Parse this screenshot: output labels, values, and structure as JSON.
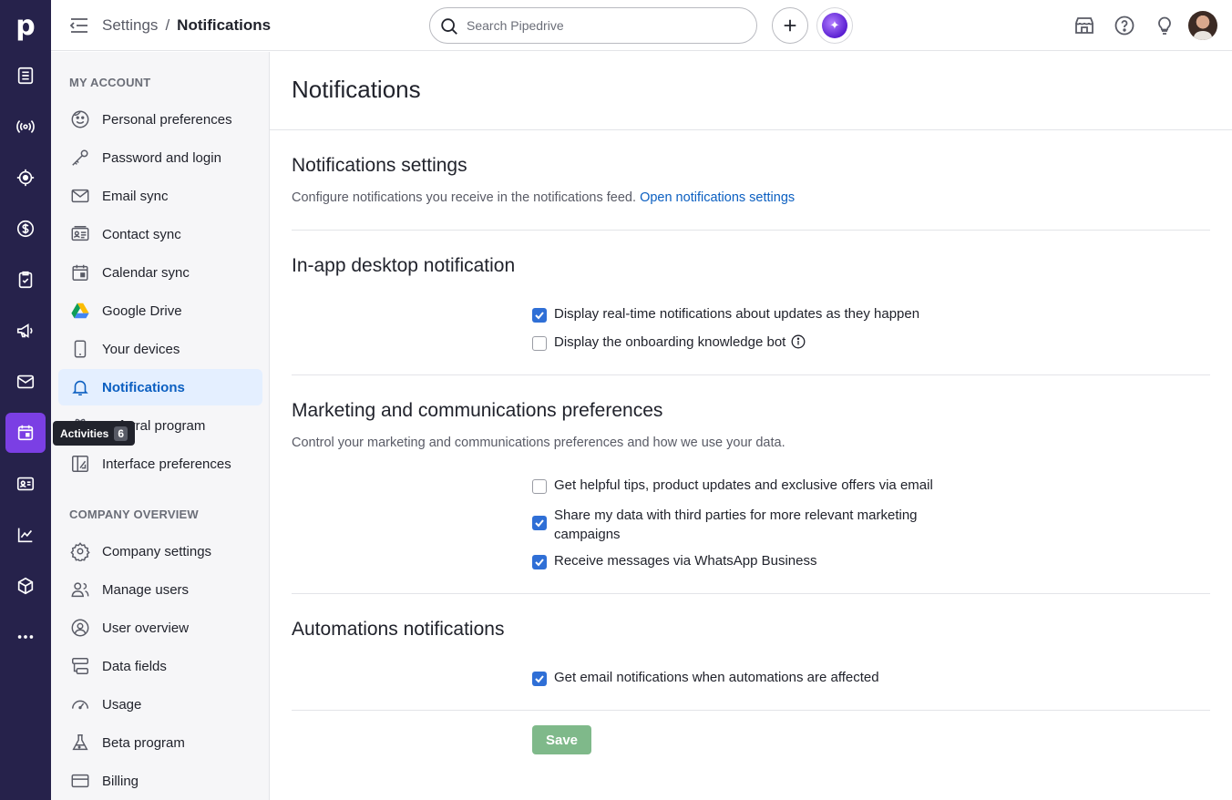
{
  "breadcrumb": {
    "parent": "Settings",
    "separator": "/",
    "current": "Notifications"
  },
  "search": {
    "placeholder": "Search Pipedrive"
  },
  "rail": {
    "logo": "p",
    "tooltip": {
      "label": "Activities",
      "count": "6"
    }
  },
  "sidebar": {
    "my_account_title": "MY ACCOUNT",
    "my_account_items": [
      {
        "label": "Personal preferences",
        "icon": "smiley-icon"
      },
      {
        "label": "Password and login",
        "icon": "key-icon"
      },
      {
        "label": "Email sync",
        "icon": "envelope-icon"
      },
      {
        "label": "Contact sync",
        "icon": "contact-card-icon"
      },
      {
        "label": "Calendar sync",
        "icon": "calendar-icon"
      },
      {
        "label": "Google Drive",
        "icon": "google-drive-icon"
      },
      {
        "label": "Your devices",
        "icon": "phone-icon"
      },
      {
        "label": "Notifications",
        "icon": "bell-icon"
      },
      {
        "label": "Referral program",
        "icon": "gift-icon"
      },
      {
        "label": "Interface preferences",
        "icon": "interface-icon"
      }
    ],
    "company_title": "COMPANY OVERVIEW",
    "company_items": [
      {
        "label": "Company settings",
        "icon": "gear-icon"
      },
      {
        "label": "Manage users",
        "icon": "users-icon"
      },
      {
        "label": "User overview",
        "icon": "user-circle-icon"
      },
      {
        "label": "Data fields",
        "icon": "data-fields-icon"
      },
      {
        "label": "Usage",
        "icon": "gauge-icon"
      },
      {
        "label": "Beta program",
        "icon": "flask-icon"
      },
      {
        "label": "Billing",
        "icon": "credit-card-icon"
      }
    ]
  },
  "main": {
    "title": "Notifications",
    "notif_settings": {
      "heading": "Notifications settings",
      "description": "Configure notifications you receive in the notifications feed.",
      "link": "Open notifications settings"
    },
    "in_app": {
      "heading": "In-app desktop notification",
      "options": [
        {
          "label": "Display real-time notifications about updates as they happen",
          "checked": true
        },
        {
          "label": "Display the onboarding knowledge bot",
          "checked": false
        }
      ]
    },
    "marketing": {
      "heading": "Marketing and communications preferences",
      "description": "Control your marketing and communications preferences and how we use your data.",
      "options": [
        {
          "label": "Get helpful tips, product updates and exclusive offers via email",
          "checked": false
        },
        {
          "label": "Share my data with third parties for more relevant marketing",
          "label2": "campaigns",
          "checked": true
        },
        {
          "label": "Receive messages via WhatsApp Business",
          "checked": true
        }
      ]
    },
    "automations": {
      "heading": "Automations notifications",
      "options": [
        {
          "label": "Get email notifications when automations are affected",
          "checked": true
        }
      ]
    },
    "save_label": "Save"
  },
  "colors": {
    "rail": "#26224b",
    "accent": "#7b3fe4",
    "link": "#0b5fc1",
    "checkbox": "#2f6fd6",
    "save": "#7fb98a"
  }
}
